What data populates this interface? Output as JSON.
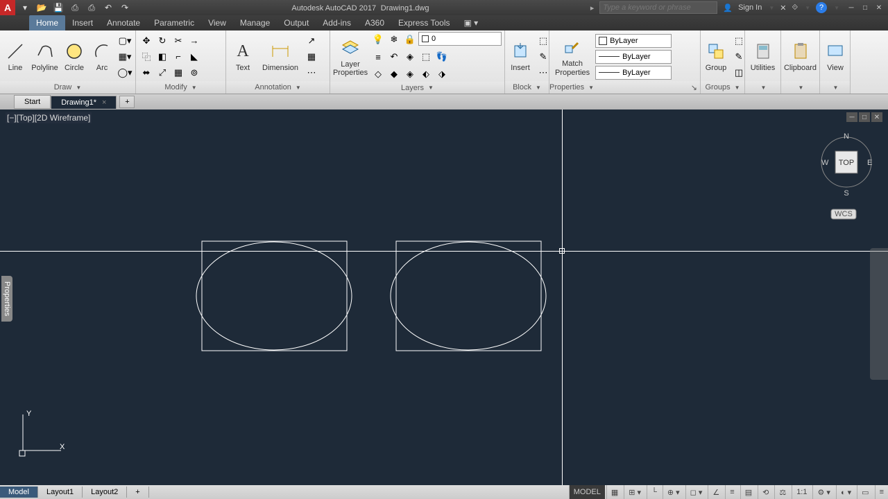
{
  "title": {
    "app": "Autodesk AutoCAD 2017",
    "doc": "Drawing1.dwg"
  },
  "search": {
    "placeholder": "Type a keyword or phrase"
  },
  "signin": "Sign In",
  "tabs": [
    "Home",
    "Insert",
    "Annotate",
    "Parametric",
    "View",
    "Manage",
    "Output",
    "Add-ins",
    "A360",
    "Express Tools"
  ],
  "tabs_active": 0,
  "panels": {
    "draw": {
      "title": "Draw",
      "items": [
        "Line",
        "Polyline",
        "Circle",
        "Arc"
      ]
    },
    "modify": {
      "title": "Modify"
    },
    "annotation": {
      "title": "Annotation",
      "items": [
        "Text",
        "Dimension"
      ]
    },
    "layers": {
      "title": "Layers",
      "props": "Layer\nProperties",
      "current": "0"
    },
    "block": {
      "title": "Block",
      "items": [
        "Insert"
      ]
    },
    "properties": {
      "title": "Properties",
      "match": "Match\nProperties",
      "bylayer": "ByLayer"
    },
    "groups": {
      "title": "Groups",
      "item": "Group"
    },
    "utilities": {
      "title": "Utilities"
    },
    "clipboard": {
      "title": "Clipboard"
    },
    "view": {
      "title": "View"
    }
  },
  "file_tabs": {
    "start": "Start",
    "drawing": "Drawing1*"
  },
  "view_label": "[−][Top][2D Wireframe]",
  "props_panel": "Properties",
  "viewcube": {
    "top": "TOP",
    "n": "N",
    "s": "S",
    "e": "E",
    "w": "W",
    "wcs": "WCS"
  },
  "ucs": {
    "x": "X",
    "y": "Y"
  },
  "layout_tabs": [
    "Model",
    "Layout1",
    "Layout2"
  ],
  "status": {
    "model": "MODEL",
    "scale": "1:1"
  }
}
